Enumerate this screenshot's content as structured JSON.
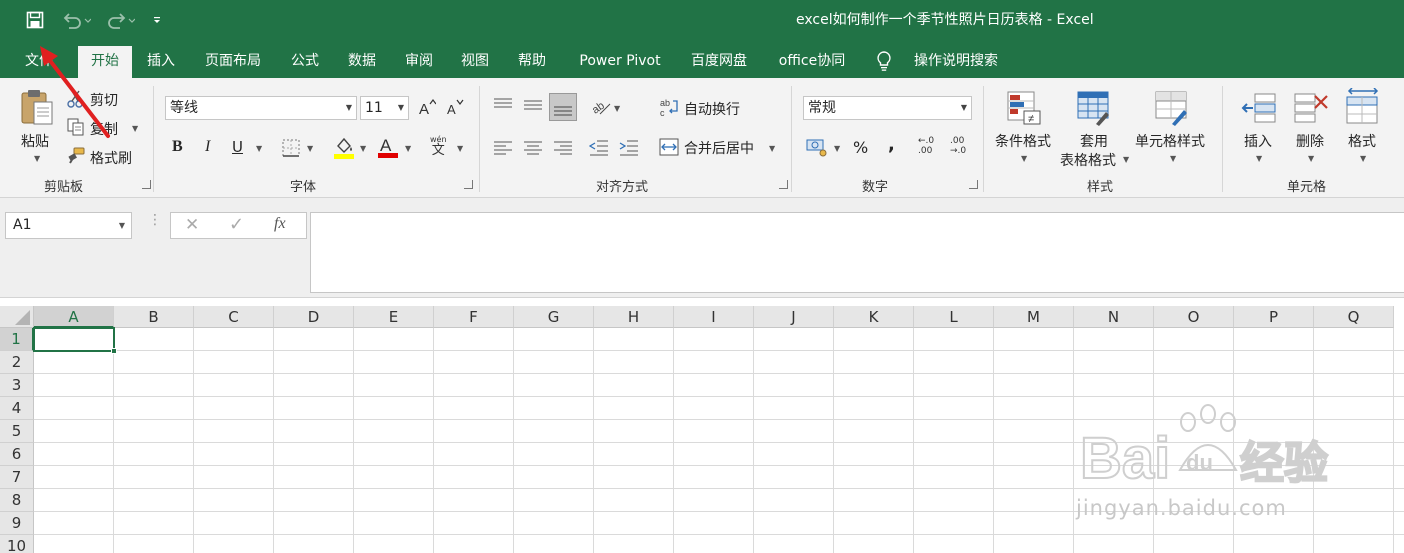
{
  "window": {
    "title": "excel如何制作一个季节性照片日历表格  -  Excel"
  },
  "quick_access": {
    "save_icon": "save-icon",
    "undo_icon": "undo-icon",
    "redo_icon": "redo-icon",
    "customize_icon": "customize-dropdown-icon"
  },
  "tabs": [
    {
      "label": "文件"
    },
    {
      "label": "开始"
    },
    {
      "label": "插入"
    },
    {
      "label": "页面布局"
    },
    {
      "label": "公式"
    },
    {
      "label": "数据"
    },
    {
      "label": "审阅"
    },
    {
      "label": "视图"
    },
    {
      "label": "帮助"
    },
    {
      "label": "Power Pivot"
    },
    {
      "label": "百度网盘"
    },
    {
      "label": "office协同"
    }
  ],
  "tell_me": {
    "label": "操作说明搜索",
    "icon": "lightbulb-icon"
  },
  "clipboard": {
    "paste": "粘贴",
    "cut": "剪切",
    "copy": "复制",
    "format_painter": "格式刷",
    "group": "剪贴板"
  },
  "font": {
    "name": "等线",
    "size": "11",
    "bold": "B",
    "italic": "I",
    "underline": "U",
    "fill_color": "#ffff00",
    "font_color": "#ff0000",
    "wen_top": "wén",
    "wen_bottom": "文",
    "group": "字体"
  },
  "alignment": {
    "wrap_text": "自动换行",
    "merge_center": "合并后居中",
    "group": "对齐方式"
  },
  "number": {
    "format": "常规",
    "percent": "%",
    "comma": ",",
    "inc_decimal_top": "←.0",
    "inc_decimal_bottom": ".00",
    "dec_decimal_top": ".00",
    "dec_decimal_bottom": "→.0",
    "group": "数字"
  },
  "styles": {
    "conditional": "条件格式",
    "table_line1": "套用",
    "table_line2": "表格格式",
    "cell_styles": "单元格样式",
    "group": "样式"
  },
  "cells": {
    "insert": "插入",
    "delete": "删除",
    "format": "格式",
    "group": "单元格"
  },
  "formula_bar": {
    "name_box": "A1",
    "cancel": "✕",
    "enter": "✓",
    "fx": "fx",
    "value": ""
  },
  "grid": {
    "columns": [
      "A",
      "B",
      "C",
      "D",
      "E",
      "F",
      "G",
      "H",
      "I",
      "J",
      "K",
      "L",
      "M",
      "N",
      "O",
      "P",
      "Q"
    ],
    "rows": [
      "1",
      "2",
      "3",
      "4",
      "5",
      "6",
      "7",
      "8",
      "9",
      "10"
    ],
    "active_cell": "A1"
  },
  "watermark": {
    "brand": "Bai",
    "brand2": "经验",
    "url": "jingyan.baidu.com"
  },
  "colors": {
    "excel_green": "#217346",
    "annotation_arrow": "#e02020"
  }
}
